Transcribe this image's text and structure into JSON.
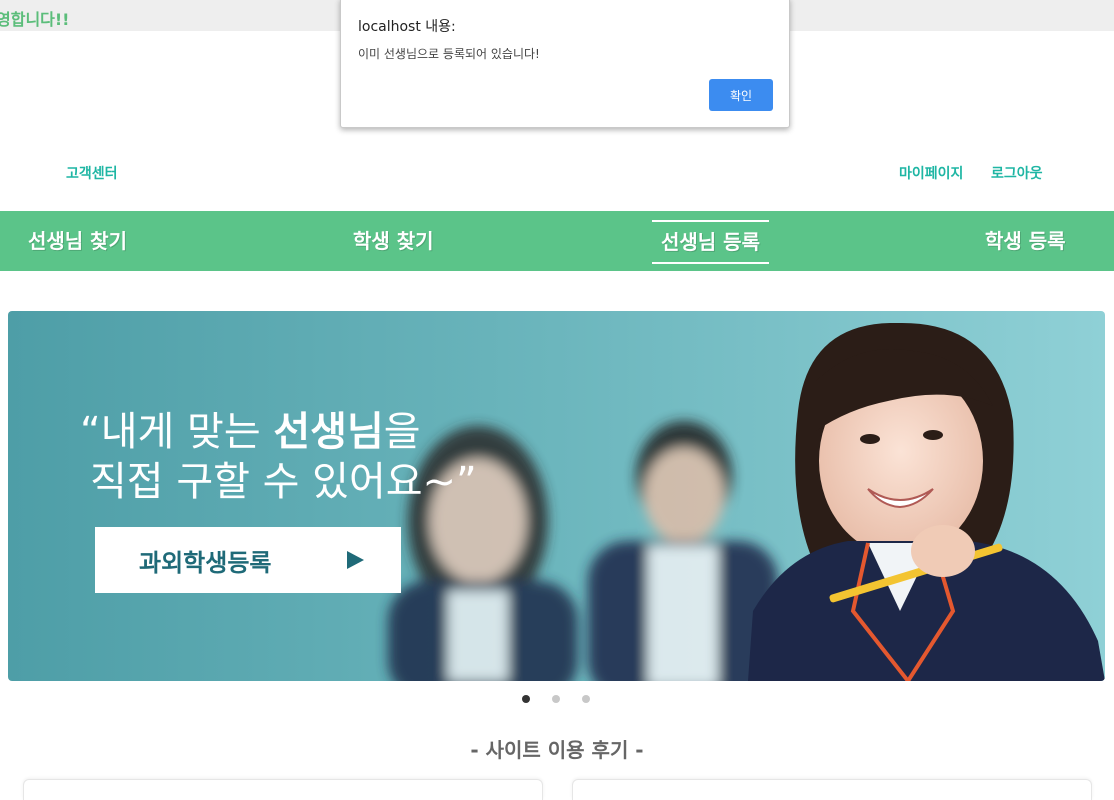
{
  "header": {
    "welcome_text": "영합니다!!",
    "customer_center": "고객센터",
    "mypage": "마이페이지",
    "logout": "로그아웃"
  },
  "nav": {
    "items": [
      {
        "label": "선생님 찾기"
      },
      {
        "label": "학생 찾기"
      },
      {
        "label": "선생님 등록"
      },
      {
        "label": "학생 등록"
      }
    ],
    "active": "선생님 등록"
  },
  "banner": {
    "headline_line1_prefix": "“내게 맞는 ",
    "headline_line1_bold": "선생님",
    "headline_line1_suffix": "을",
    "headline_line2": "직접 구할 수 있어요~”",
    "cta_label": "과외학생등록",
    "cta_icon": "play-triangle-icon"
  },
  "carousel": {
    "slide_count": 3,
    "active_index": 0
  },
  "section": {
    "title": "- 사이트 이용 후기 -"
  },
  "dialog": {
    "title": "localhost 내용:",
    "message": "이미 선생님으로 등록되어 있습니다!",
    "ok_label": "확인"
  },
  "colors": {
    "nav_green": "#5bc489",
    "link_teal": "#1fb6a4",
    "dialog_button": "#3c8cf0",
    "banner_teal": "#5aa7b0"
  }
}
